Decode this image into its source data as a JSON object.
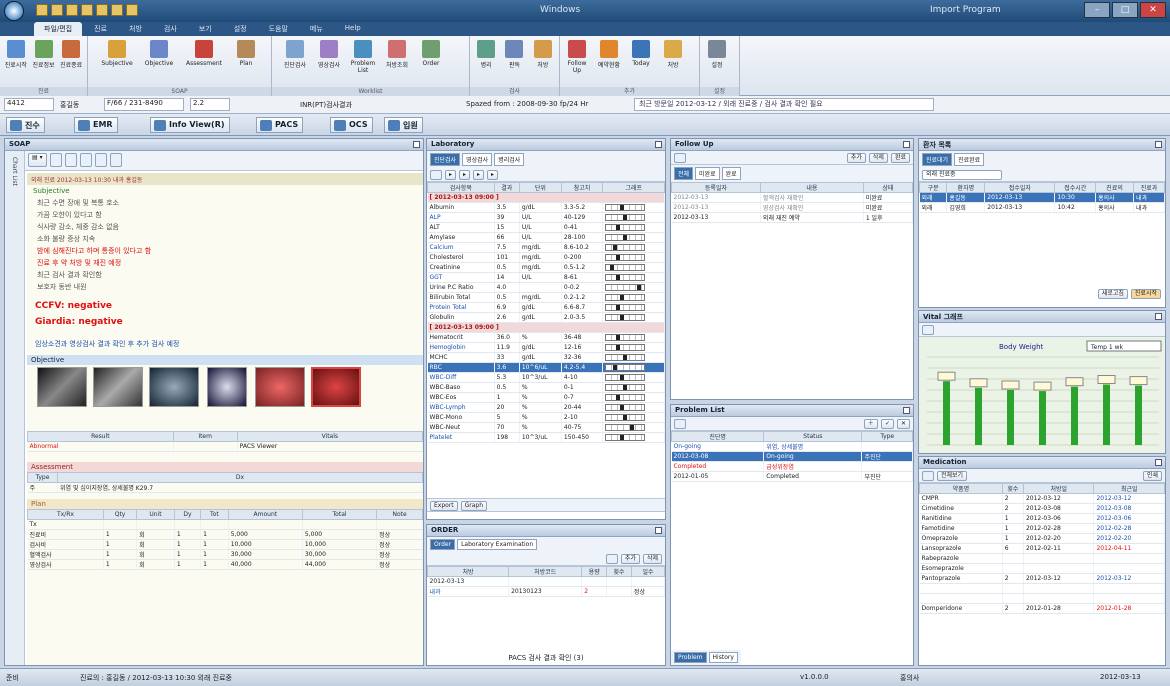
{
  "window": {
    "title": "Windows",
    "subtitle": "Import Program"
  },
  "menu": [
    "파일/편집",
    "진료",
    "처방",
    "검사",
    "보기",
    "설정",
    "도움말",
    "메뉴",
    "Help"
  ],
  "ribbon": {
    "groups": [
      {
        "label": "진료",
        "items": [
          "진료시작",
          "진료정보",
          "진료종료"
        ]
      },
      {
        "label": "SOAP",
        "items": [
          "Subjective",
          "Objective",
          "Assessment",
          "Plan"
        ]
      },
      {
        "label": "Worklist",
        "items": [
          "진단검사",
          "영상검사",
          "Problem List",
          "처방조회",
          "Order"
        ]
      },
      {
        "label": "검사",
        "items": [
          "병리",
          "판독",
          "처방"
        ]
      },
      {
        "label": "추가",
        "items": [
          "Follow Up",
          "예약현황",
          "Today",
          "처방"
        ]
      },
      {
        "label": "설정",
        "items": [
          "설정"
        ]
      }
    ]
  },
  "patient": {
    "id": "4412",
    "name": "홍길동",
    "info": "F/66 / 231-8490",
    "code": "2.2",
    "message": "INR(PT)검사결과",
    "note": "Spazed from : 2008-09-30 fp/24 Hr",
    "alert": "최근 방문일 2012-03-12 / 외래 진료중 / 검사 결과 확인 필요"
  },
  "tabs": [
    {
      "label": "진수"
    },
    {
      "label": "EMR"
    },
    {
      "label": "Info View(R)"
    },
    {
      "label": "PACS"
    },
    {
      "label": "OCS"
    },
    {
      "label": "입원"
    }
  ],
  "soap": {
    "title": "SOAP",
    "side_label": "Chart List",
    "note_header": "외래 진료 2012-03-13 10:30 내과 홍길동",
    "sections": [
      "Subjective",
      "Objective",
      "Assessment",
      "Plan"
    ],
    "subjective": [
      "최근 수면 장애 및 복통 호소",
      "가끔 오한이 있다고 함",
      "식사량 감소, 체중 감소 없음",
      "소화 불량 증상 지속",
      "밤에 심해진다고 하며 통증이 있다고 함",
      "진료 후 약 처방 및 재진 예정",
      "최근 검사 결과 확인함",
      "보호자 동반 내원"
    ],
    "findings": [
      "CCFV: negative",
      "Giardia: negative"
    ],
    "comment": "임상소견과 영상검사 결과 확인 후 추가 검사 예정",
    "images": [
      "endoscopy-1",
      "endoscopy-2",
      "xray-chest",
      "xray-bone",
      "photo-1",
      "photo-2"
    ],
    "result_header": [
      "Result",
      "Item",
      "Vitals"
    ],
    "result_row": [
      "Abnormal",
      "",
      "PACS Viewer"
    ],
    "assessment_header": [
      "Type",
      "Dx"
    ],
    "assessment_row": [
      "주",
      "위염 및 십이지장염, 상세불명 K29.7"
    ],
    "plan_header": [
      "Tx/Rx",
      "Qty",
      "Unit",
      "Dy",
      "Tot",
      "Amount",
      "Total",
      "Note"
    ],
    "plan_rows": [
      [
        "Tx",
        "",
        "",
        "",
        "",
        "",
        "",
        ""
      ],
      [
        "진료비",
        "1",
        "회",
        "1",
        "1",
        "5,000",
        "5,000",
        "정상"
      ],
      [
        "검사비",
        "1",
        "회",
        "1",
        "1",
        "10,000",
        "10,000",
        "정상"
      ],
      [
        "혈액검사",
        "1",
        "회",
        "1",
        "1",
        "30,000",
        "30,000",
        "정상"
      ],
      [
        "영상검사",
        "1",
        "회",
        "1",
        "1",
        "40,000",
        "44,000",
        "정상"
      ]
    ]
  },
  "laboratory": {
    "title": "Laboratory",
    "subtabs": [
      "진단검사",
      "영상검사",
      "병리검사"
    ],
    "header": [
      "검사항목",
      "결과",
      "단위",
      "참고치",
      "그래프"
    ],
    "groups": [
      {
        "label": "[ 2012-03-13 09:00 ]",
        "rows": [
          [
            "Albumin",
            "3.5",
            "g/dL",
            "3.3-5.2",
            0.4
          ],
          [
            "ALP",
            "39",
            "U/L",
            "40-129",
            0.5
          ],
          [
            "ALT",
            "15",
            "U/L",
            "0-41",
            0.3
          ],
          [
            "Amylase",
            "66",
            "U/L",
            "28-100",
            0.5
          ],
          [
            "Calcium",
            "7.5",
            "mg/dL",
            "8.6-10.2",
            0.2
          ],
          [
            "Cholesterol",
            "101",
            "mg/dL",
            "0-200",
            0.3
          ],
          [
            "Creatinine",
            "0.5",
            "mg/dL",
            "0.5-1.2",
            0.1
          ],
          [
            "GGT",
            "14",
            "U/L",
            "8-61",
            0.3
          ],
          [
            "Urine P.C Ratio",
            "4.0",
            "",
            "0-0.2",
            0.9
          ],
          [
            "Bilirubin Total",
            "0.5",
            "mg/dL",
            "0.2-1.2",
            0.4
          ],
          [
            "Protein Total",
            "6.9",
            "g/dL",
            "6.6-8.7",
            0.3
          ],
          [
            "Globulin",
            "2.6",
            "g/dL",
            "2.0-3.5",
            0.4
          ]
        ]
      },
      {
        "label": "[ 2012-03-13 09:00 ]",
        "rows": [
          [
            "Hematocrit",
            "36.0",
            "%",
            "36-48",
            0.3
          ],
          [
            "Hemoglobin",
            "11.9",
            "g/dL",
            "12-16",
            0.3
          ],
          [
            "MCHC",
            "33",
            "g/dL",
            "32-36",
            0.5
          ],
          [
            "RBC",
            "3.6",
            "10^6/uL",
            "4.2-5.4",
            0.2
          ],
          [
            "WBC-Diff",
            "5.3",
            "10^3/uL",
            "4-10",
            0.4
          ],
          [
            "WBC-Baso",
            "0.5",
            "%",
            "0-1",
            0.5
          ],
          [
            "WBC-Eos",
            "1",
            "%",
            "0-7",
            0.3
          ],
          [
            "WBC-Lymph",
            "20",
            "%",
            "20-44",
            0.4
          ],
          [
            "WBC-Mono",
            "5",
            "%",
            "2-10",
            0.5
          ],
          [
            "WBC-Neut",
            "70",
            "%",
            "40-75",
            0.7
          ],
          [
            "Platelet",
            "198",
            "10^3/uL",
            "150-450",
            0.4
          ]
        ]
      }
    ],
    "buttons": [
      "Export",
      "Graph"
    ]
  },
  "followup": {
    "title": "Follow Up",
    "buttons": [
      "추가",
      "삭제",
      "완료"
    ],
    "subtabs": [
      "전체",
      "미완료",
      "완료"
    ],
    "header": [
      "등록일자",
      "내용",
      "상태"
    ],
    "rows": [
      [
        "2012-03-13",
        "혈액검사 재확인",
        "미완료"
      ],
      [
        "2012-03-13",
        "영상검사 재확인",
        "미완료"
      ],
      [
        "2012-03-13",
        "외래 재진 예약",
        "1 일후"
      ]
    ]
  },
  "problems": {
    "title": "Problem List",
    "header": [
      "진단명",
      "Status",
      "Type"
    ],
    "items": [
      {
        "label": "On-going",
        "date": "2012-03-08",
        "status": "On-going",
        "detail": "위염, 상세불명",
        "type": "주진단"
      },
      {
        "label": "Completed",
        "date": "2012-01-05",
        "status": "Completed",
        "detail": "급성위장염",
        "type": "부진단"
      }
    ],
    "subtabs": [
      "Problem",
      "History"
    ]
  },
  "order": {
    "title": "ORDER",
    "subtabs": [
      "Order",
      "Laboratory Examination"
    ],
    "buttons": [
      "추가",
      "삭제"
    ],
    "header": [
      "처방",
      "처방코드",
      "용량",
      "횟수",
      "일수"
    ],
    "rows": [
      [
        "2012-03-13",
        "",
        "",
        "",
        ""
      ],
      [
        "내과",
        "20130123",
        "2",
        "",
        "정상"
      ]
    ],
    "status": "PACS 검사 결과 확인 (3)"
  },
  "patient_list": {
    "title": "환자 목록",
    "subtabs": [
      "진료대기",
      "진료완료"
    ],
    "filter": "외래 진료중",
    "header": [
      "구분",
      "환자명",
      "접수일자",
      "접수시간",
      "진료의",
      "진료과"
    ],
    "rows": [
      [
        "외래",
        "홍길동",
        "2012-03-13",
        "10:30",
        "홍의사",
        "내과"
      ],
      [
        "외래",
        "김영희",
        "2012-03-13",
        "10:42",
        "홍의사",
        "내과"
      ]
    ],
    "buttons": [
      "새로고침",
      "진료시작"
    ]
  },
  "vital": {
    "title": "Vital 그래프",
    "chart_title": "Body Weight",
    "dropdown": "Temp 1 wk"
  },
  "history": {
    "title": "Medication",
    "buttons": [
      "전체보기",
      "인쇄"
    ],
    "header": [
      "약품명",
      "횟수",
      "처방일",
      "최근일"
    ],
    "rows": [
      [
        "CMPR",
        "2",
        "2012-03-12",
        "2012-03-12"
      ],
      [
        "Cimetidine",
        "2",
        "2012-03-08",
        "2012-03-08"
      ],
      [
        "Ranitidine",
        "1",
        "2012-03-06",
        "2012-03-06"
      ],
      [
        "Famotidine",
        "1",
        "2012-02-28",
        "2012-02-28"
      ],
      [
        "Omeprazole",
        "1",
        "2012-02-20",
        "2012-02-20"
      ],
      [
        "Lansoprazole",
        "6",
        "2012-02-11",
        "2012-04-11"
      ],
      [
        "Rabeprazole",
        "",
        "",
        ""
      ],
      [
        "Esomeprazole",
        "",
        "",
        ""
      ],
      [
        "Pantoprazole",
        "2",
        "2012-03-12",
        "2012-03-12"
      ],
      [
        "",
        "",
        "",
        ""
      ],
      [
        "",
        "",
        "",
        ""
      ],
      [
        "Domperidone",
        "2",
        "2012-01-28",
        "2012-01-28"
      ]
    ]
  },
  "chart_data": {
    "type": "bar",
    "title": "Body Weight",
    "categories": [
      "1",
      "2",
      "3",
      "4",
      "5",
      "6",
      "7"
    ],
    "series": [
      {
        "values": [
          58,
          52,
          50,
          49,
          53,
          55,
          54
        ]
      }
    ],
    "ylim": [
      0,
      80
    ]
  },
  "statusbar": {
    "left": "준비",
    "center": "진료의 : 홍길동 / 2012-03-13 10:30 외래 진료중",
    "version": "v1.0.0.0",
    "user": "홍의사",
    "date": "2012-03-13"
  },
  "colors": {
    "accent": "#3b73b9",
    "alert": "#d11111",
    "grid": "#2ca32c"
  }
}
